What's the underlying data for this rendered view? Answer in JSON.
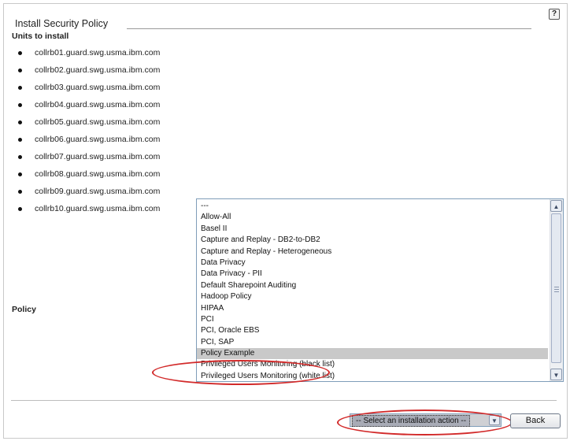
{
  "header": {
    "title": "Install Security Policy",
    "help_icon": "help-icon",
    "help_glyph": "?"
  },
  "units": {
    "label": "Units to install",
    "items": [
      "collrb01.guard.swg.usma.ibm.com",
      "collrb02.guard.swg.usma.ibm.com",
      "collrb03.guard.swg.usma.ibm.com",
      "collrb04.guard.swg.usma.ibm.com",
      "collrb05.guard.swg.usma.ibm.com",
      "collrb06.guard.swg.usma.ibm.com",
      "collrb07.guard.swg.usma.ibm.com",
      "collrb08.guard.swg.usma.ibm.com",
      "collrb09.guard.swg.usma.ibm.com",
      "collrb10.guard.swg.usma.ibm.com"
    ]
  },
  "policy": {
    "label": "Policy",
    "selected": "Policy Example",
    "options": [
      "---",
      "Allow-All",
      "Basel II",
      "Capture and Replay - DB2-to-DB2",
      "Capture and Replay - Heterogeneous",
      "Data Privacy",
      "Data Privacy - PII",
      "Default Sharepoint Auditing",
      "Hadoop Policy",
      "HIPAA",
      "PCI",
      "PCI, Oracle EBS",
      "PCI, SAP",
      "Policy Example",
      "Privileged Users Monitoring (black list)",
      "Privileged Users Monitoring (white list)"
    ]
  },
  "actions": {
    "installation_select_value": "-- Select an installation action --",
    "back_label": "Back"
  },
  "annotations": {
    "highlight_color": "#d22a2a"
  }
}
